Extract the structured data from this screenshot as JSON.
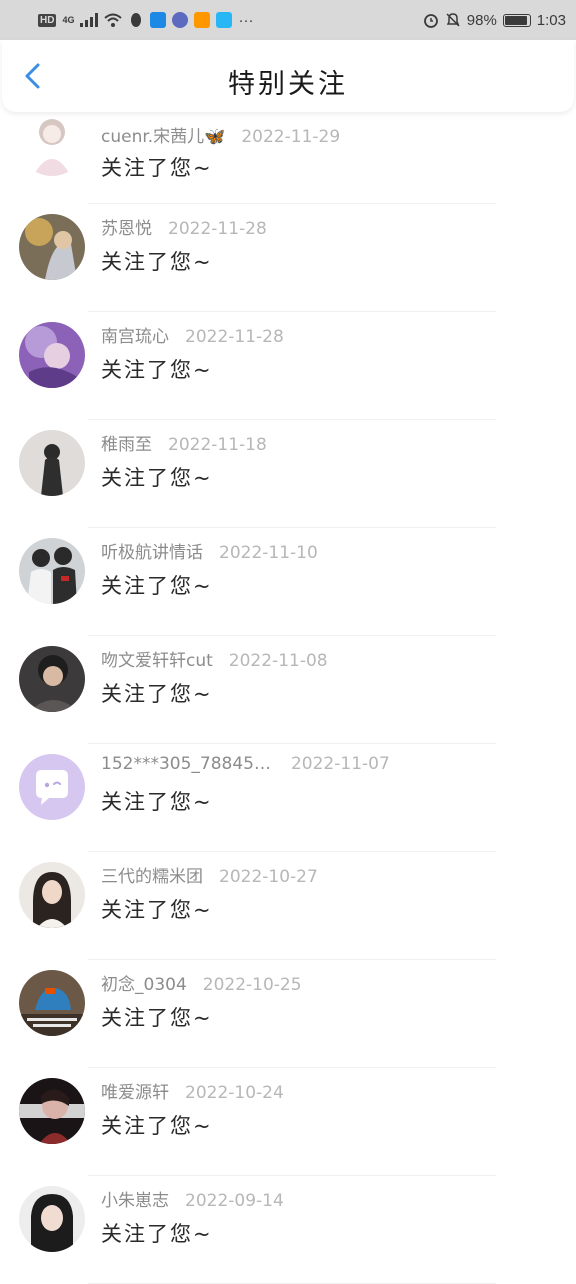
{
  "status_bar": {
    "hd": "HD",
    "network": "4G",
    "battery_percent": "98%",
    "time": "1:03"
  },
  "header": {
    "title": "特别关注"
  },
  "items": [
    {
      "name": "cuenr.宋茜儿🦋",
      "date": "2022-11-29",
      "message": "关注了您~"
    },
    {
      "name": "苏恩悦",
      "date": "2022-11-28",
      "message": "关注了您~"
    },
    {
      "name": "南宫琉心",
      "date": "2022-11-28",
      "message": "关注了您~"
    },
    {
      "name": "稚雨至",
      "date": "2022-11-18",
      "message": "关注了您~"
    },
    {
      "name": "听极航讲情话",
      "date": "2022-11-10",
      "message": "关注了您~"
    },
    {
      "name": "吻文爱轩轩cut",
      "date": "2022-11-08",
      "message": "关注了您~"
    },
    {
      "name": "152***305_78845…",
      "date": "2022-11-07",
      "message": "关注了您~"
    },
    {
      "name": "三代的糯米团",
      "date": "2022-10-27",
      "message": "关注了您~"
    },
    {
      "name": "初念_0304",
      "date": "2022-10-25",
      "message": "关注了您~"
    },
    {
      "name": "唯爱源轩",
      "date": "2022-10-24",
      "message": "关注了您~"
    },
    {
      "name": "小朱崽志",
      "date": "2022-09-14",
      "message": "关注了您~"
    }
  ],
  "colors": {
    "accent": "#3a8ee6",
    "date": "#b7b7b7",
    "name": "#8c8c8c"
  }
}
